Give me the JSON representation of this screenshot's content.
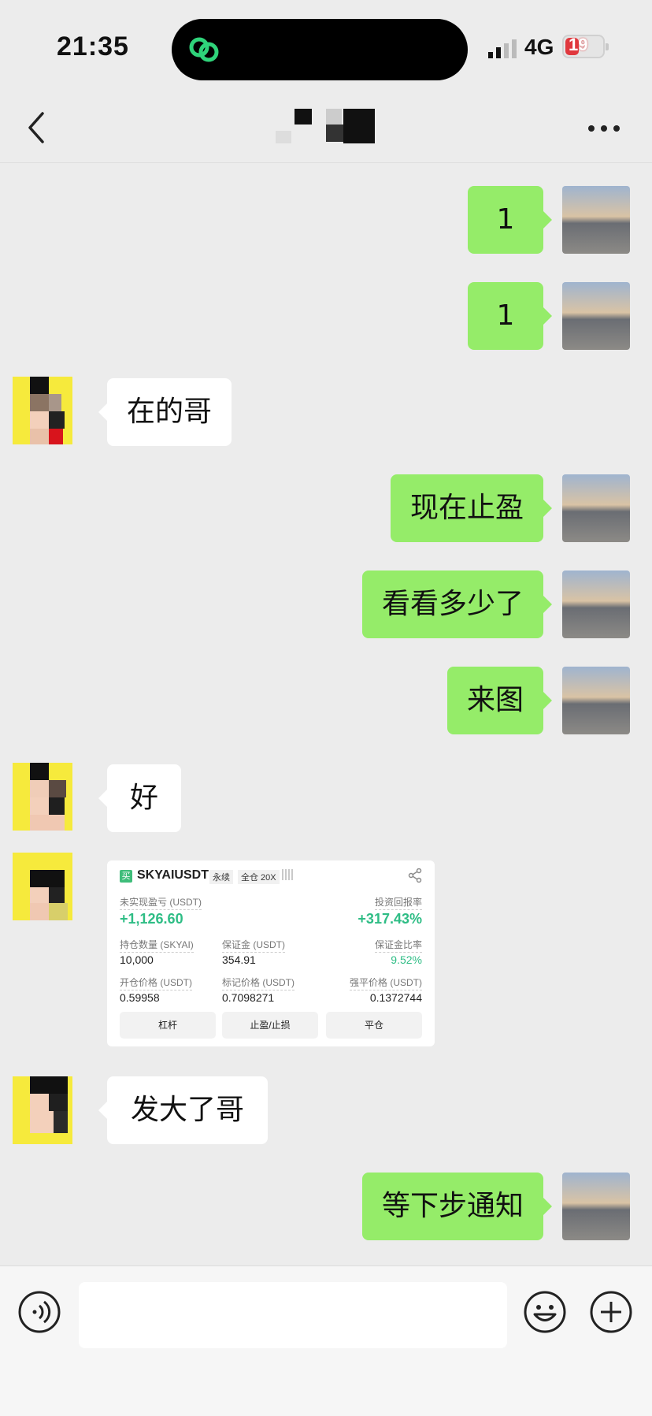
{
  "status_bar": {
    "time": "21:35",
    "network": "4G",
    "battery": "19"
  },
  "nav": {
    "title": ""
  },
  "messages": [
    {
      "side": "out",
      "text": "1"
    },
    {
      "side": "out",
      "text": "1"
    },
    {
      "side": "in",
      "text": "在的哥"
    },
    {
      "side": "out",
      "text": "现在止盈"
    },
    {
      "side": "out",
      "text": "看看多少了"
    },
    {
      "side": "out",
      "text": "来图"
    },
    {
      "side": "in",
      "text": "好"
    },
    {
      "side": "in",
      "type": "image"
    },
    {
      "side": "in",
      "text": "发大了哥"
    },
    {
      "side": "out",
      "text": "等下步通知"
    }
  ],
  "trade_card": {
    "tag": "买",
    "symbol": "SKYAIUSDT",
    "perpetual": "永续",
    "margin_mode": "全仓 20X",
    "unrealized_pnl_label": "未实现盈亏 (USDT)",
    "unrealized_pnl": "+1,126.60",
    "roi_label": "投资回报率",
    "roi": "+317.43%",
    "position_label": "持仓数量 (SKYAI)",
    "position": "10,000",
    "margin_label": "保证金 (USDT)",
    "margin": "354.91",
    "margin_ratio_label": "保证金比率",
    "margin_ratio": "9.52%",
    "entry_label": "开仓价格 (USDT)",
    "entry": "0.59958",
    "mark_label": "标记价格 (USDT)",
    "mark": "0.7098271",
    "liq_label": "强平价格 (USDT)",
    "liq": "0.1372744",
    "btn_leverage": "杠杆",
    "btn_tpsl": "止盈/止损",
    "btn_close": "平仓"
  },
  "input_bar": {
    "value": ""
  },
  "icons": [
    "back-icon",
    "more-icon",
    "voice-icon",
    "emoji-icon",
    "plus-icon",
    "share-icon"
  ],
  "colors": {
    "outgoing_bubble": "#95ec69",
    "incoming_bubble": "#ffffff",
    "background": "#ececec",
    "profit_green": "#2ebd85"
  }
}
